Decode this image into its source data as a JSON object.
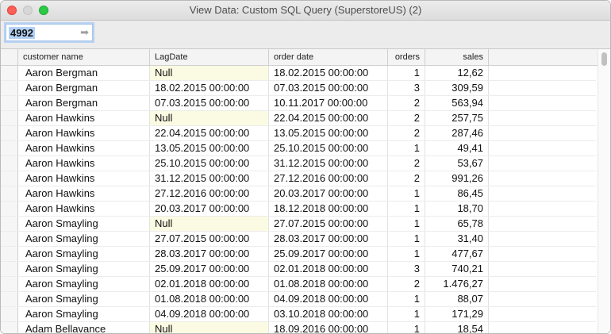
{
  "window": {
    "title": "View Data:  Custom SQL Query (SuperstoreUS) (2)"
  },
  "toolbar": {
    "row_count": "4992",
    "go_icon": "arrow-right-icon"
  },
  "table": {
    "columns": [
      "customer name",
      "LagDate",
      "order date",
      "orders",
      "sales"
    ],
    "rows": [
      [
        "Aaron Bergman",
        "Null",
        "18.02.2015 00:00:00",
        "1",
        "12,62"
      ],
      [
        "Aaron Bergman",
        "18.02.2015 00:00:00",
        "07.03.2015 00:00:00",
        "3",
        "309,59"
      ],
      [
        "Aaron Bergman",
        "07.03.2015 00:00:00",
        "10.11.2017 00:00:00",
        "2",
        "563,94"
      ],
      [
        "Aaron Hawkins",
        "Null",
        "22.04.2015 00:00:00",
        "2",
        "257,75"
      ],
      [
        "Aaron Hawkins",
        "22.04.2015 00:00:00",
        "13.05.2015 00:00:00",
        "2",
        "287,46"
      ],
      [
        "Aaron Hawkins",
        "13.05.2015 00:00:00",
        "25.10.2015 00:00:00",
        "1",
        "49,41"
      ],
      [
        "Aaron Hawkins",
        "25.10.2015 00:00:00",
        "31.12.2015 00:00:00",
        "2",
        "53,67"
      ],
      [
        "Aaron Hawkins",
        "31.12.2015 00:00:00",
        "27.12.2016 00:00:00",
        "2",
        "991,26"
      ],
      [
        "Aaron Hawkins",
        "27.12.2016 00:00:00",
        "20.03.2017 00:00:00",
        "1",
        "86,45"
      ],
      [
        "Aaron Hawkins",
        "20.03.2017 00:00:00",
        "18.12.2018 00:00:00",
        "1",
        "18,70"
      ],
      [
        "Aaron Smayling",
        "Null",
        "27.07.2015 00:00:00",
        "1",
        "65,78"
      ],
      [
        "Aaron Smayling",
        "27.07.2015 00:00:00",
        "28.03.2017 00:00:00",
        "1",
        "31,40"
      ],
      [
        "Aaron Smayling",
        "28.03.2017 00:00:00",
        "25.09.2017 00:00:00",
        "1",
        "477,67"
      ],
      [
        "Aaron Smayling",
        "25.09.2017 00:00:00",
        "02.01.2018 00:00:00",
        "3",
        "740,21"
      ],
      [
        "Aaron Smayling",
        "02.01.2018 00:00:00",
        "01.08.2018 00:00:00",
        "2",
        "1.476,27"
      ],
      [
        "Aaron Smayling",
        "01.08.2018 00:00:00",
        "04.09.2018 00:00:00",
        "1",
        "88,07"
      ],
      [
        "Aaron Smayling",
        "04.09.2018 00:00:00",
        "03.10.2018 00:00:00",
        "1",
        "171,29"
      ],
      [
        "Adam Bellavance",
        "Null",
        "18.09.2016 00:00:00",
        "1",
        "18,54"
      ]
    ]
  },
  "colors": {
    "null_cell": "#fbfbe3",
    "selection": "#b3d1f7",
    "close": "#fe5f57",
    "maximize": "#2aca44"
  }
}
